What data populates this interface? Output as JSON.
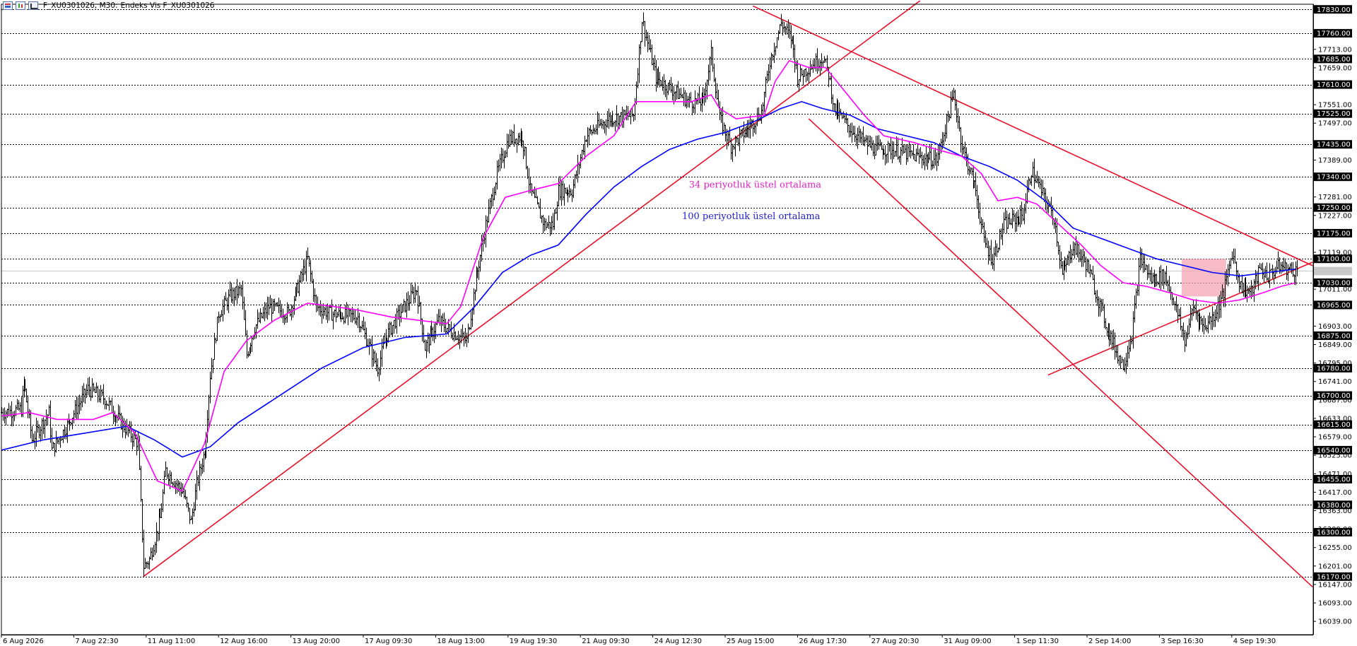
{
  "header": {
    "symbol": "F_XU0301026, M30:",
    "description": "Endeks Vis F_XU0301026",
    "icons": [
      "chart-window-icon",
      "bars-icon",
      "line-chart-icon"
    ]
  },
  "chart_data": {
    "type": "line",
    "title": "",
    "price_type": "ohlc-bars",
    "ylim": [
      16000,
      17845
    ],
    "y_ticks": [
      17713,
      17659,
      17551,
      17497,
      17389,
      17281,
      17227,
      17119,
      17011,
      16903,
      16849,
      16795,
      16741,
      16687,
      16633,
      16579,
      16525,
      16471,
      16417,
      16363,
      16309,
      16255,
      16201,
      16147,
      16093,
      16039
    ],
    "y_tick_labels": [
      "17713.00",
      "17659.00",
      "17551.00",
      "17497.00",
      "17389.00",
      "17281.00",
      "17227.00",
      "17119.00",
      "17011.00",
      "16903.00",
      "16849.00",
      "16795.00",
      "16741.00",
      "16687.00",
      "16633.00",
      "16579.00",
      "16525.00",
      "16471.00",
      "16417.00",
      "16363.00",
      "16309.00",
      "16255.00",
      "16201.00",
      "16147.00",
      "16093.00",
      "16039.00"
    ],
    "levels": [
      17830,
      17760,
      17685,
      17610,
      17525,
      17435,
      17340,
      17250,
      17175,
      17100,
      17030,
      16965,
      16875,
      16780,
      16700,
      16615,
      16540,
      16455,
      16380,
      16300,
      16170
    ],
    "level_labels": [
      "17830.00",
      "17760.00",
      "17685.00",
      "17610.00",
      "17525.00",
      "17435.00",
      "17340.00",
      "17250.00",
      "17175.00",
      "17100.00",
      "17030.00",
      "16965.00",
      "16875.00",
      "16780.00",
      "16700.00",
      "16615.00",
      "16540.00",
      "16455.00",
      "16380.00",
      "16300.00",
      "16170.00"
    ],
    "current_price": 17066,
    "x_labels": [
      "6 Aug 2026",
      "7 Aug 22:30",
      "11 Aug 11:00",
      "12 Aug 16:00",
      "13 Aug 20:00",
      "17 Aug 09:30",
      "18 Aug 13:00",
      "19 Aug 19:30",
      "21 Aug 09:30",
      "24 Aug 12:30",
      "25 Aug 15:00",
      "26 Aug 17:30",
      "27 Aug 20:30",
      "31 Aug 09:00",
      "1 Sep 11:30",
      "2 Sep 14:00",
      "3 Sep 16:30",
      "4 Sep 19:30"
    ],
    "x_tick_index": [
      0,
      52,
      104,
      156,
      208,
      260,
      312,
      364,
      416,
      468,
      520,
      572,
      624,
      676,
      728,
      780,
      832,
      884
    ],
    "xlim": [
      0,
      942
    ],
    "path_points": [
      [
        0,
        16650
      ],
      [
        14,
        16660
      ],
      [
        16,
        16740
      ],
      [
        22,
        16570
      ],
      [
        34,
        16650
      ],
      [
        36,
        16540
      ],
      [
        48,
        16620
      ],
      [
        62,
        16720
      ],
      [
        74,
        16690
      ],
      [
        86,
        16620
      ],
      [
        98,
        16560
      ],
      [
        102,
        16200
      ],
      [
        106,
        16220
      ],
      [
        114,
        16340
      ],
      [
        118,
        16480
      ],
      [
        130,
        16420
      ],
      [
        136,
        16330
      ],
      [
        140,
        16440
      ],
      [
        146,
        16540
      ],
      [
        150,
        16760
      ],
      [
        156,
        16940
      ],
      [
        164,
        16990
      ],
      [
        172,
        17010
      ],
      [
        176,
        16820
      ],
      [
        182,
        16900
      ],
      [
        192,
        16960
      ],
      [
        206,
        16940
      ],
      [
        220,
        17100
      ],
      [
        226,
        16960
      ],
      [
        236,
        16940
      ],
      [
        256,
        16930
      ],
      [
        270,
        16780
      ],
      [
        276,
        16870
      ],
      [
        286,
        16940
      ],
      [
        298,
        17010
      ],
      [
        304,
        16840
      ],
      [
        314,
        16920
      ],
      [
        322,
        16890
      ],
      [
        334,
        16860
      ],
      [
        340,
        17020
      ],
      [
        348,
        17200
      ],
      [
        356,
        17350
      ],
      [
        364,
        17450
      ],
      [
        374,
        17460
      ],
      [
        380,
        17300
      ],
      [
        390,
        17200
      ],
      [
        396,
        17200
      ],
      [
        400,
        17300
      ],
      [
        410,
        17300
      ],
      [
        420,
        17460
      ],
      [
        436,
        17510
      ],
      [
        454,
        17520
      ],
      [
        460,
        17800
      ],
      [
        470,
        17630
      ],
      [
        480,
        17600
      ],
      [
        494,
        17560
      ],
      [
        504,
        17560
      ],
      [
        510,
        17700
      ],
      [
        516,
        17510
      ],
      [
        524,
        17430
      ],
      [
        536,
        17480
      ],
      [
        546,
        17530
      ],
      [
        552,
        17680
      ],
      [
        560,
        17790
      ],
      [
        568,
        17740
      ],
      [
        572,
        17630
      ],
      [
        580,
        17660
      ],
      [
        590,
        17690
      ],
      [
        594,
        17640
      ],
      [
        598,
        17540
      ],
      [
        610,
        17480
      ],
      [
        620,
        17440
      ],
      [
        628,
        17420
      ],
      [
        640,
        17420
      ],
      [
        656,
        17400
      ],
      [
        672,
        17390
      ],
      [
        684,
        17580
      ],
      [
        690,
        17430
      ],
      [
        700,
        17300
      ],
      [
        706,
        17150
      ],
      [
        712,
        17100
      ],
      [
        720,
        17200
      ],
      [
        730,
        17220
      ],
      [
        734,
        17230
      ],
      [
        740,
        17360
      ],
      [
        750,
        17270
      ],
      [
        756,
        17220
      ],
      [
        762,
        17050
      ],
      [
        770,
        17140
      ],
      [
        780,
        17080
      ],
      [
        794,
        16900
      ],
      [
        802,
        16820
      ],
      [
        806,
        16790
      ],
      [
        812,
        16880
      ],
      [
        818,
        17100
      ],
      [
        826,
        17040
      ],
      [
        836,
        17050
      ],
      [
        842,
        16980
      ],
      [
        850,
        16860
      ],
      [
        856,
        16960
      ],
      [
        864,
        16900
      ],
      [
        872,
        16940
      ],
      [
        878,
        17000
      ],
      [
        884,
        17120
      ],
      [
        890,
        17020
      ],
      [
        898,
        17000
      ],
      [
        904,
        17070
      ],
      [
        910,
        17050
      ],
      [
        918,
        17080
      ],
      [
        924,
        17070
      ],
      [
        930,
        17066
      ]
    ],
    "ema34": [
      [
        0,
        16640
      ],
      [
        20,
        16650
      ],
      [
        40,
        16630
      ],
      [
        66,
        16630
      ],
      [
        80,
        16650
      ],
      [
        96,
        16590
      ],
      [
        112,
        16450
      ],
      [
        130,
        16420
      ],
      [
        146,
        16560
      ],
      [
        160,
        16770
      ],
      [
        176,
        16860
      ],
      [
        196,
        16920
      ],
      [
        220,
        16970
      ],
      [
        240,
        16960
      ],
      [
        256,
        16950
      ],
      [
        280,
        16930
      ],
      [
        300,
        16920
      ],
      [
        320,
        16910
      ],
      [
        330,
        16960
      ],
      [
        346,
        17160
      ],
      [
        362,
        17280
      ],
      [
        380,
        17300
      ],
      [
        400,
        17320
      ],
      [
        420,
        17400
      ],
      [
        440,
        17460
      ],
      [
        456,
        17560
      ],
      [
        476,
        17560
      ],
      [
        496,
        17560
      ],
      [
        510,
        17580
      ],
      [
        516,
        17540
      ],
      [
        528,
        17510
      ],
      [
        548,
        17520
      ],
      [
        556,
        17620
      ],
      [
        566,
        17680
      ],
      [
        580,
        17660
      ],
      [
        592,
        17660
      ],
      [
        604,
        17600
      ],
      [
        620,
        17520
      ],
      [
        634,
        17460
      ],
      [
        656,
        17440
      ],
      [
        672,
        17420
      ],
      [
        690,
        17400
      ],
      [
        704,
        17350
      ],
      [
        716,
        17270
      ],
      [
        730,
        17280
      ],
      [
        744,
        17260
      ],
      [
        760,
        17200
      ],
      [
        776,
        17140
      ],
      [
        790,
        17080
      ],
      [
        806,
        17030
      ],
      [
        822,
        17020
      ],
      [
        840,
        17000
      ],
      [
        856,
        16980
      ],
      [
        874,
        16970
      ],
      [
        890,
        16980
      ],
      [
        906,
        17000
      ],
      [
        920,
        17020
      ],
      [
        930,
        17030
      ]
    ],
    "ema100": [
      [
        0,
        16540
      ],
      [
        30,
        16570
      ],
      [
        60,
        16590
      ],
      [
        90,
        16610
      ],
      [
        110,
        16570
      ],
      [
        130,
        16520
      ],
      [
        150,
        16550
      ],
      [
        170,
        16620
      ],
      [
        200,
        16700
      ],
      [
        230,
        16780
      ],
      [
        260,
        16840
      ],
      [
        290,
        16870
      ],
      [
        320,
        16880
      ],
      [
        340,
        16960
      ],
      [
        360,
        17060
      ],
      [
        380,
        17110
      ],
      [
        400,
        17140
      ],
      [
        420,
        17230
      ],
      [
        440,
        17310
      ],
      [
        460,
        17370
      ],
      [
        480,
        17420
      ],
      [
        500,
        17450
      ],
      [
        520,
        17470
      ],
      [
        540,
        17500
      ],
      [
        560,
        17540
      ],
      [
        575,
        17560
      ],
      [
        590,
        17540
      ],
      [
        610,
        17520
      ],
      [
        630,
        17480
      ],
      [
        650,
        17460
      ],
      [
        670,
        17440
      ],
      [
        690,
        17400
      ],
      [
        710,
        17370
      ],
      [
        730,
        17330
      ],
      [
        750,
        17270
      ],
      [
        770,
        17190
      ],
      [
        790,
        17160
      ],
      [
        810,
        17130
      ],
      [
        830,
        17100
      ],
      [
        850,
        17080
      ],
      [
        870,
        17060
      ],
      [
        890,
        17050
      ],
      [
        910,
        17060
      ],
      [
        930,
        17070
      ]
    ],
    "trendlines": [
      [
        [
          102,
          16170
        ],
        [
          660,
          17855
        ]
      ],
      [
        [
          540,
          17840
        ],
        [
          942,
          17080
        ]
      ],
      [
        [
          580,
          17510
        ],
        [
          942,
          16140
        ]
      ],
      [
        [
          752,
          16760
        ],
        [
          942,
          17090
        ]
      ]
    ],
    "rectangle": {
      "x0": 848,
      "x1": 880,
      "y0": 16990,
      "y1": 17100
    },
    "annotations": [
      {
        "text": "34 periyotluk üstel ortalama",
        "color": "#e020c0",
        "x": 494,
        "y": 17308
      },
      {
        "text": "100 periyotluk üstel ortalama",
        "color": "#2020d0",
        "x": 489,
        "y": 17216
      }
    ],
    "colors": {
      "price": "#000000",
      "ema34": "#ff00ff",
      "ema100": "#0000ff",
      "trend": "#e8102a",
      "level": "#000000",
      "rect": "#f4a6b4"
    },
    "grid": false,
    "legend": "none"
  }
}
